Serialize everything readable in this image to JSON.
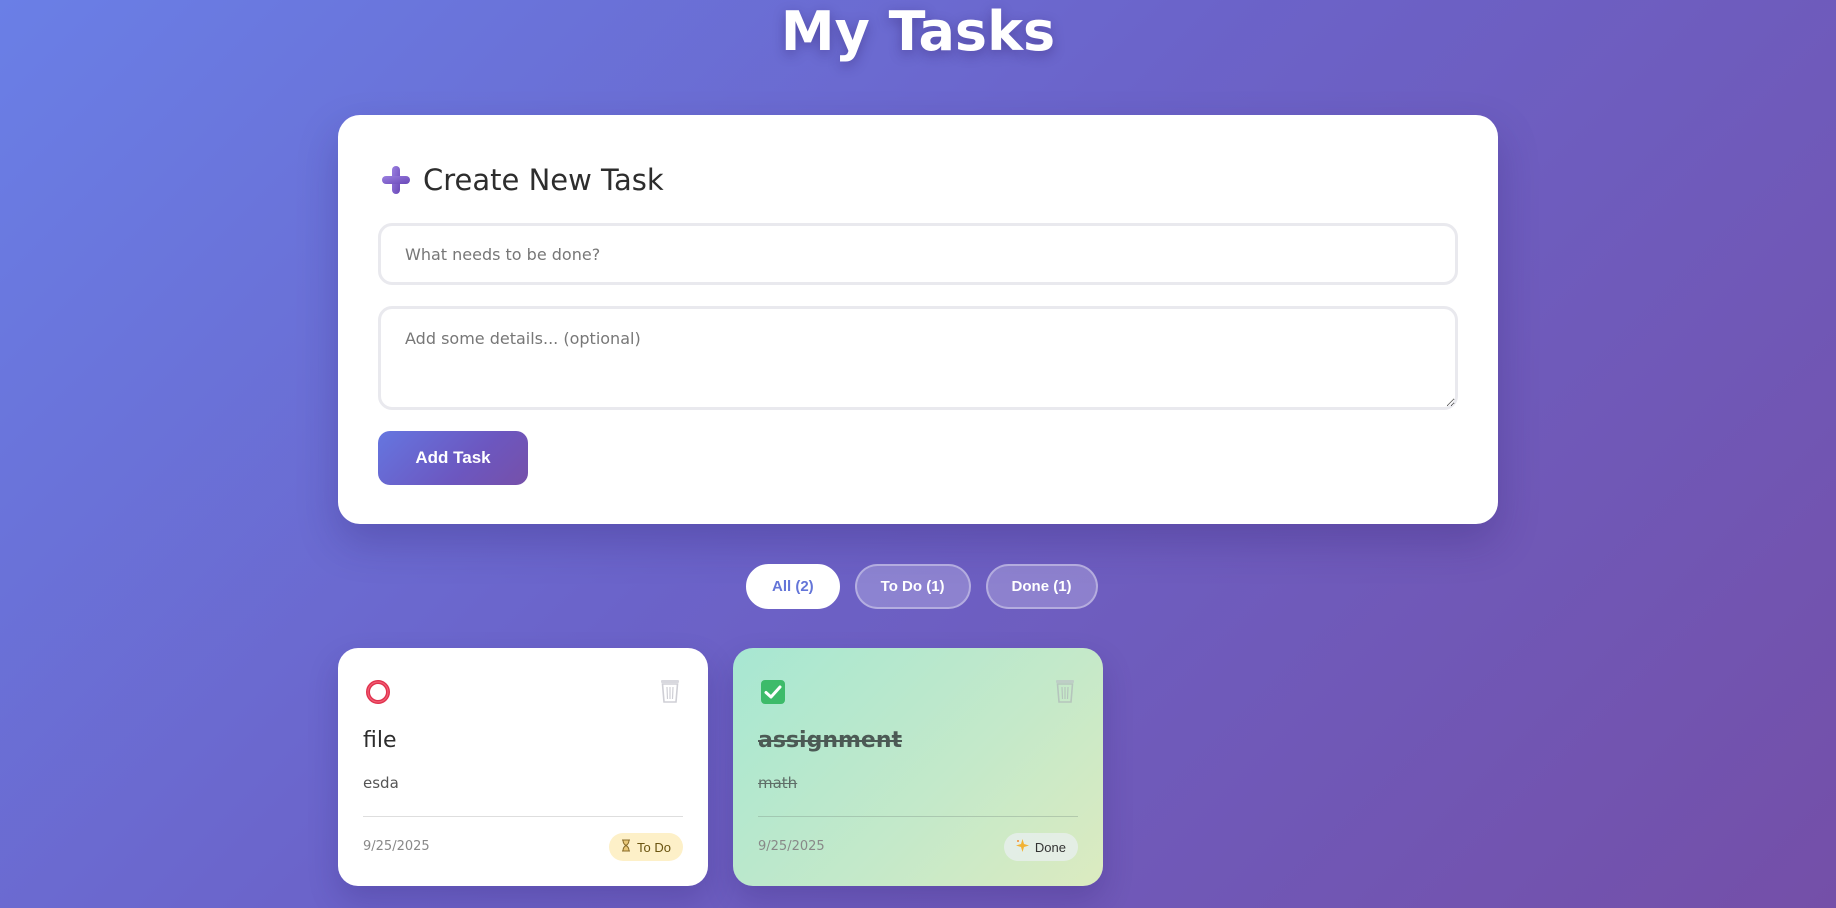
{
  "page": {
    "title": "My Tasks"
  },
  "create": {
    "title": "Create New Task",
    "title_placeholder": "What needs to be done?",
    "details_placeholder": "Add some details... (optional)",
    "title_value": "",
    "details_value": "",
    "add_label": "Add Task"
  },
  "filters": [
    {
      "label": "All (2)",
      "active": true
    },
    {
      "label": "To Do (1)",
      "active": false
    },
    {
      "label": "Done (1)",
      "active": false
    }
  ],
  "tasks": [
    {
      "title": "file",
      "description": "esda",
      "date": "9/25/2025",
      "status": "To Do",
      "status_icon": "hourglass-icon",
      "completed": false
    },
    {
      "title": "assignment",
      "description": "math",
      "date": "9/25/2025",
      "status": "Done",
      "status_icon": "sparkle-icon",
      "completed": true
    }
  ],
  "colors": {
    "accent": "#6576e0",
    "todo_badge": "#fdf0c8",
    "check_green": "#3dbb6a",
    "circle_red": "#e0334f"
  }
}
